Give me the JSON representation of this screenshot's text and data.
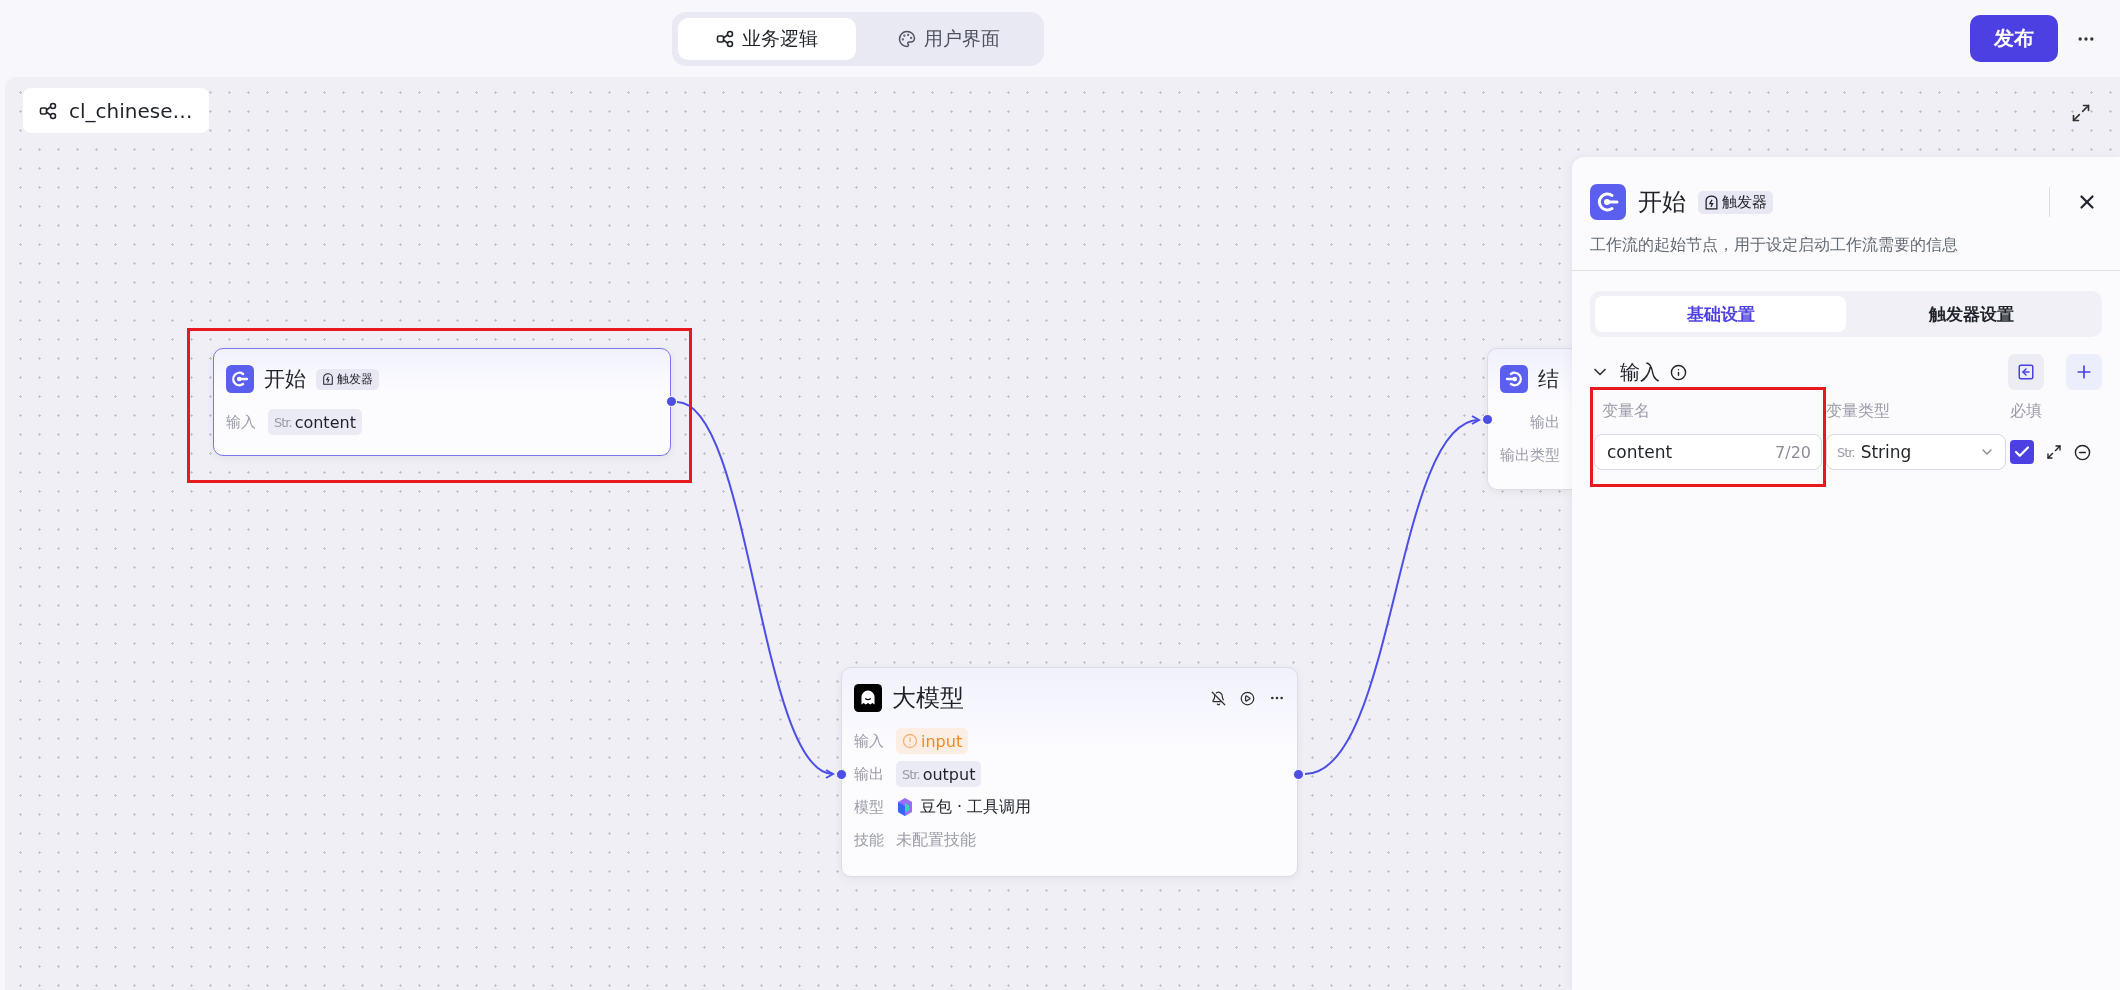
{
  "tabs": [
    {
      "label": "业务逻辑",
      "kind": "flow",
      "selected": true
    },
    {
      "label": "用户界面",
      "kind": "palette",
      "selected": false
    }
  ],
  "publish_button": "发布",
  "canvas": {
    "title": "cl_chinese…"
  },
  "nodes": [
    {
      "kind": "start",
      "title": "开始",
      "badge": "触发器",
      "highlighted": true,
      "rows": [
        {
          "label": "输入",
          "kind": "typed",
          "type": "Str.",
          "value": "content"
        }
      ]
    },
    {
      "kind": "llm",
      "title": "大模型",
      "highlighted": false,
      "rows": [
        {
          "label": "输入",
          "kind": "warning",
          "value": "input"
        },
        {
          "label": "输出",
          "kind": "typed",
          "type": "Str.",
          "value": "output"
        },
        {
          "label": "模型",
          "kind": "model",
          "value": "豆包 · 工具调用"
        },
        {
          "label": "技能",
          "kind": "empty",
          "value": "未配置技能"
        }
      ]
    },
    {
      "kind": "end",
      "title": "结",
      "highlighted": false,
      "rows": [
        {
          "label": "输出",
          "kind": "label"
        },
        {
          "label": "输出类型",
          "kind": "label"
        }
      ]
    }
  ],
  "panel": {
    "title": "开始",
    "badge": "触发器",
    "description": "工作流的起始节点，用于设定启动工作流需要的信息",
    "tabs": [
      {
        "label": "基础设置",
        "selected": true
      },
      {
        "label": "触发器设置",
        "selected": false
      }
    ],
    "section": {
      "title": "输入",
      "expanded": true
    },
    "columns": [
      {
        "label": "变量名"
      },
      {
        "label": "变量类型"
      },
      {
        "label": "必填"
      }
    ],
    "variables": [
      {
        "name": "content",
        "counter": "7/20",
        "type_tag": "Str.",
        "type": "String",
        "required": true,
        "highlighted": true
      }
    ]
  }
}
